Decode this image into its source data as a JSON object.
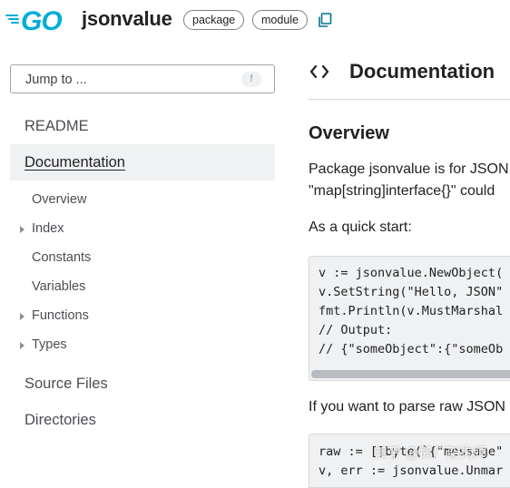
{
  "header": {
    "package_name": "jsonvalue",
    "chips": [
      "package",
      "module"
    ],
    "logo_text": "GO",
    "accent": "#00add8"
  },
  "sidebar": {
    "jump_placeholder": "Jump to ...",
    "jump_shortcut": "f",
    "readme": "README",
    "documentation": "Documentation",
    "sub_items": [
      {
        "label": "Overview",
        "expandable": false
      },
      {
        "label": "Index",
        "expandable": true
      },
      {
        "label": "Constants",
        "expandable": false
      },
      {
        "label": "Variables",
        "expandable": false
      },
      {
        "label": "Functions",
        "expandable": true
      },
      {
        "label": "Types",
        "expandable": true
      }
    ],
    "source_files": "Source Files",
    "directories": "Directories"
  },
  "main": {
    "title": "Documentation",
    "overview_heading": "Overview",
    "paragraphs": [
      "Package jsonvalue is for JSON",
      "\"map[string]interface{}\" could",
      "As a quick start:",
      "If you want to parse raw JSON"
    ],
    "code1": [
      "v := jsonvalue.NewObject(",
      "v.SetString(\"Hello, JSON\"",
      "fmt.Println(v.MustMarshal",
      "// Output:",
      "// {\"someObject\":{\"someOb"
    ],
    "code2": [
      "raw := []byte(`{\"message\"",
      "v, err := jsonvalue.Unmar"
    ]
  },
  "watermark": "知乎 @鹅厂架构师"
}
